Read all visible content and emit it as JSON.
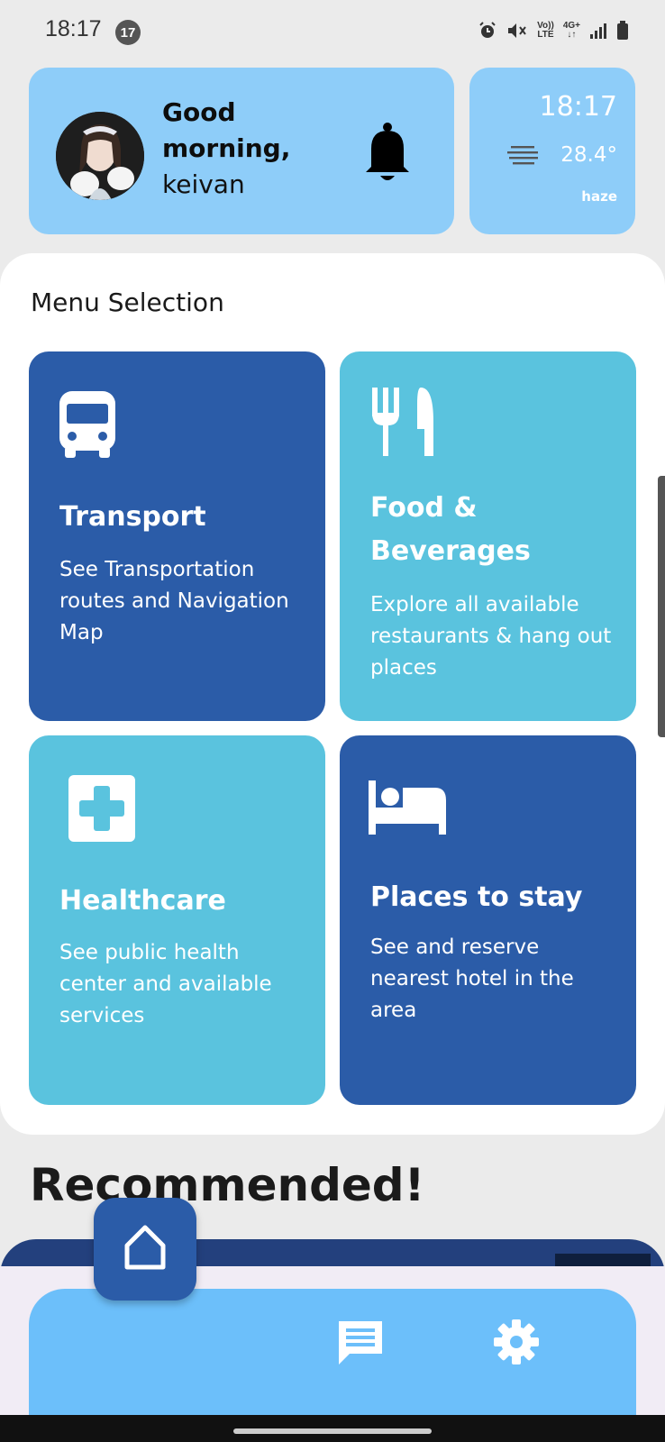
{
  "status_bar": {
    "time": "18:17",
    "notification_count": "17",
    "volte_label_top": "Vo))",
    "volte_label_bottom": "LTE",
    "network_label": "4G+"
  },
  "greeting": {
    "line1": "Good",
    "line2": "morning,",
    "name": "keivan",
    "bell_icon": "bell-icon"
  },
  "weather": {
    "time": "18:17",
    "temperature": "28.4°",
    "condition": "haze",
    "icon": "haze-icon"
  },
  "menu": {
    "title": "Menu Selection",
    "tiles": [
      {
        "title": "Transport",
        "description": "See Transportation routes and Navigation Map",
        "icon": "bus-icon",
        "color": "#2b5ca8"
      },
      {
        "title": "Food & Beverages",
        "description": "Explore all available restaurants & hang out places",
        "icon": "utensils-icon",
        "color": "#5ac3de"
      },
      {
        "title": "Healthcare",
        "description": "See public health center and available services",
        "icon": "medical-cross-icon",
        "color": "#5ac3de"
      },
      {
        "title": "Places to stay",
        "description": "See and reserve nearest hotel in the area",
        "icon": "bed-icon",
        "color": "#2b5ca8"
      }
    ]
  },
  "recommended": {
    "title": "Recommended!"
  },
  "bottom_nav": {
    "items": [
      "home-icon",
      "chat-icon",
      "settings-icon"
    ],
    "accent": "#6cbffa"
  }
}
